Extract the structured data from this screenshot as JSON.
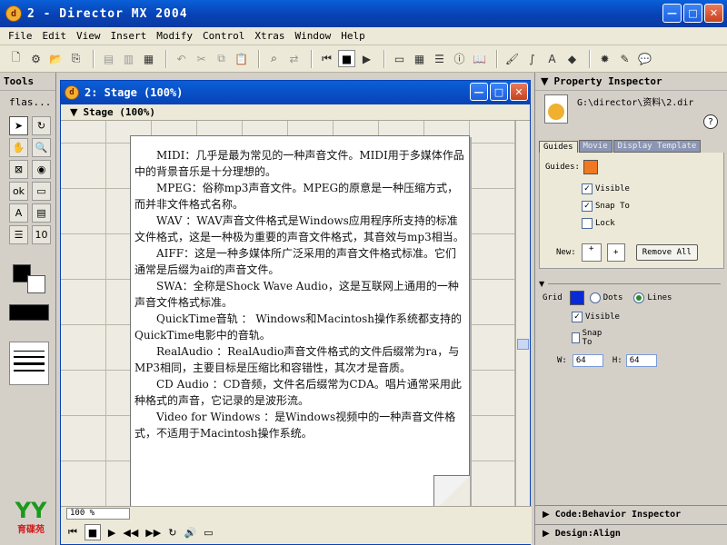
{
  "app": {
    "title": "2 - Director MX 2004",
    "icon_letter": "d"
  },
  "menu": [
    "File",
    "Edit",
    "View",
    "Insert",
    "Modify",
    "Control",
    "Xtras",
    "Window",
    "Help"
  ],
  "tools": {
    "title": "Tools",
    "selector": "flas..."
  },
  "stage": {
    "window_title": "2: Stage (100%)",
    "header_label": "Stage (100%)",
    "zoom": "100 %",
    "paragraphs": [
      "MIDI：几乎是最为常见的一种声音文件。MIDI用于多媒体作品中的背景音乐是十分理想的。",
      "MPEG：俗称mp3声音文件。MPEG的原意是一种压缩方式，而并非文件格式名称。",
      "WAV ：WAV声音文件格式是Windows应用程序所支持的标准文件格式，这是一种极为重要的声音文件格式，其音效与mp3相当。",
      "AIFF：这是一种多媒体所广泛采用的声音文件格式标准。它们通常是后缀为aif的声音文件。",
      "SWA：全称是Shock Wave Audio，这是互联网上通用的一种声音文件格式标准。",
      "QuickTime音轨 ： Windows和Macintosh操作系统都支持的QuickTime电影中的音轨。",
      "RealAudio ：RealAudio声音文件格式的文件后缀常为ra，与MP3相同，主要目标是压缩比和容错性，其次才是音质。",
      "CD Audio ：CD音频，文件名后缀常为CDA。唱片通常采用此种格式的声音，它记录的是波形流。",
      "Video for Windows ：是Windows视频中的一种声音文件格式，不适用于Macintosh操作系统。"
    ]
  },
  "inspector": {
    "title": "Property Inspector",
    "path": "G:\\director\\资料\\2.dir",
    "help": "?",
    "tabs": [
      "Guides",
      "Movie",
      "Display Template"
    ],
    "guides": {
      "label": "Guides:",
      "color": "#f07820",
      "visible": "Visible",
      "snap_to": "Snap To",
      "lock": "Lock",
      "new_label": "New:",
      "remove_all": "Remove All"
    },
    "grid": {
      "label": "Grid",
      "color": "#0a2ad8",
      "dots": "Dots",
      "lines": "Lines",
      "visible": "Visible",
      "snap_to": "Snap To",
      "w_label": "W:",
      "w_value": "64",
      "h_label": "H:",
      "h_value": "64"
    },
    "code_panel": "Code:Behavior Inspector",
    "design_panel": "Design:Align"
  },
  "logo_text": "育碟苑"
}
